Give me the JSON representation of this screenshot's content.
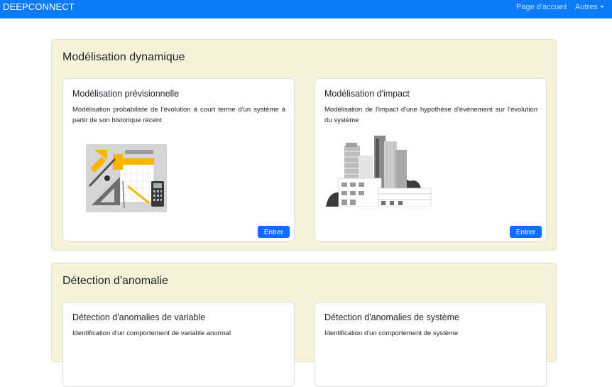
{
  "navbar": {
    "brand": "DEEPCONNECT",
    "home_label": "Page d'accueil",
    "more_label": "Autres"
  },
  "sections": [
    {
      "title": "Modélisation dynamique",
      "cards": [
        {
          "title": "Modélisation prévisionnelle",
          "text": "Modélisation probabiliste de l'évolution à court terme d'un système à partir de son historique récent",
          "button": "Entrer",
          "illustration": "tools-drafting-icon"
        },
        {
          "title": "Modélisation d'impact",
          "text": "Modélisation de l'impact d'une hypothèse d'évènement sur l'évolution du système",
          "button": "Entrer",
          "illustration": "city-buildings-icon"
        }
      ]
    },
    {
      "title": "Détection d'anomalie",
      "cards": [
        {
          "title": "Détection d'anomalies de variable",
          "text": "Identification d'un comportement de variable anormal"
        },
        {
          "title": "Détection d'anomalies de système",
          "text": "Identification d'un comportement de système"
        }
      ]
    }
  ],
  "colors": {
    "navbar": "#0d7bf7",
    "section_bg": "#f4f2d8",
    "button": "#0d6efd",
    "accent_yellow": "#f7b500"
  }
}
